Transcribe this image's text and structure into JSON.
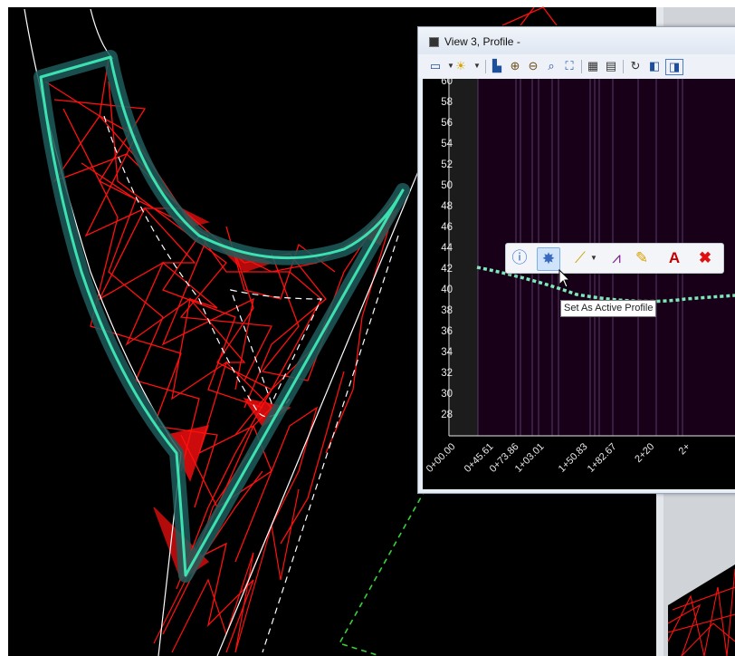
{
  "window": {
    "title": "View 3, Profile -"
  },
  "toolbar": {
    "icons": [
      "view-attributes-icon",
      "brightness-icon",
      "fill-icon",
      "zoom-in-icon",
      "zoom-out-icon",
      "zoom-area-icon",
      "fit-view-icon",
      "window-area-icon",
      "view-toggle-icon",
      "rotate-icon",
      "previous-view-icon",
      "next-view-icon"
    ]
  },
  "profile": {
    "y_ticks": [
      "60",
      "58",
      "56",
      "54",
      "52",
      "50",
      "48",
      "46",
      "44",
      "42",
      "40",
      "38",
      "36",
      "34",
      "32",
      "30",
      "28"
    ],
    "x_ticks": [
      "0+00.00",
      "0+45.61",
      "0+73.86",
      "1+03.01",
      "1+50.83",
      "1+82.67",
      "2+20",
      "2+"
    ]
  },
  "context_toolbar": {
    "icons": [
      "element-info-icon",
      "set-active-profile-icon",
      "measure-icon",
      "profile-icon",
      "pencil-icon",
      "text-icon",
      "delete-icon"
    ],
    "tooltip": "Set As Active Profile"
  },
  "colors": {
    "triangles": "#ff1010",
    "boundary": "#3de0b0",
    "profile_bg": "#180018",
    "profile_line": "#7ee8b8"
  }
}
